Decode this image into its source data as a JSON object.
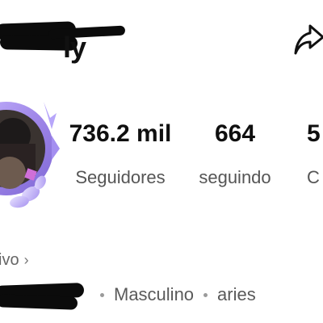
{
  "header": {
    "username_visible_tail": "ly",
    "share_icon": "share-arrow-icon"
  },
  "stats": [
    {
      "value": "736.2 mil",
      "label": "Seguidores"
    },
    {
      "value": "664",
      "label": "seguindo"
    },
    {
      "value": "5",
      "label": "C"
    }
  ],
  "badge_row": {
    "label": "ivo",
    "chevron_icon": "chevron-right-icon"
  },
  "tags": [
    "Masculino",
    "aries"
  ],
  "colors": {
    "text_primary": "#0f0f0f",
    "text_secondary": "#555555",
    "avatar_ring": "#9f86e8",
    "redaction": "#0b0b0b"
  }
}
